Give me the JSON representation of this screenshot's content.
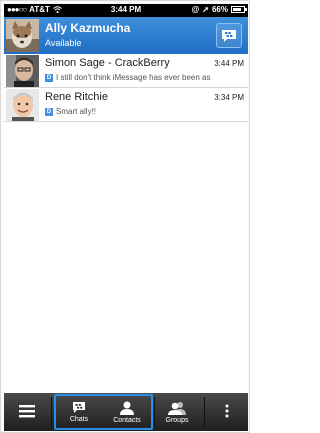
{
  "status_bar": {
    "carrier": "AT&T",
    "time": "3:44 PM",
    "battery": "66%",
    "battery_level": 0.66
  },
  "header": {
    "name": "Ally Kazmucha",
    "status": "Available"
  },
  "chats": [
    {
      "name": "Simon Sage - CrackBerry",
      "time": "3:44 PM",
      "preview": "I still don't think iMessage has ever been as",
      "delivered_badge": "D"
    },
    {
      "name": "Rene Ritchie",
      "time": "3:34 PM",
      "preview": "Smart ally!!",
      "delivered_badge": "D"
    }
  ],
  "tabs": {
    "chats": "Chats",
    "contacts": "Contacts",
    "groups": "Groups"
  },
  "colors": {
    "header": "#2a7dd0",
    "highlight": "#2a8de6",
    "bottom_bar": "#2e2e2e"
  }
}
